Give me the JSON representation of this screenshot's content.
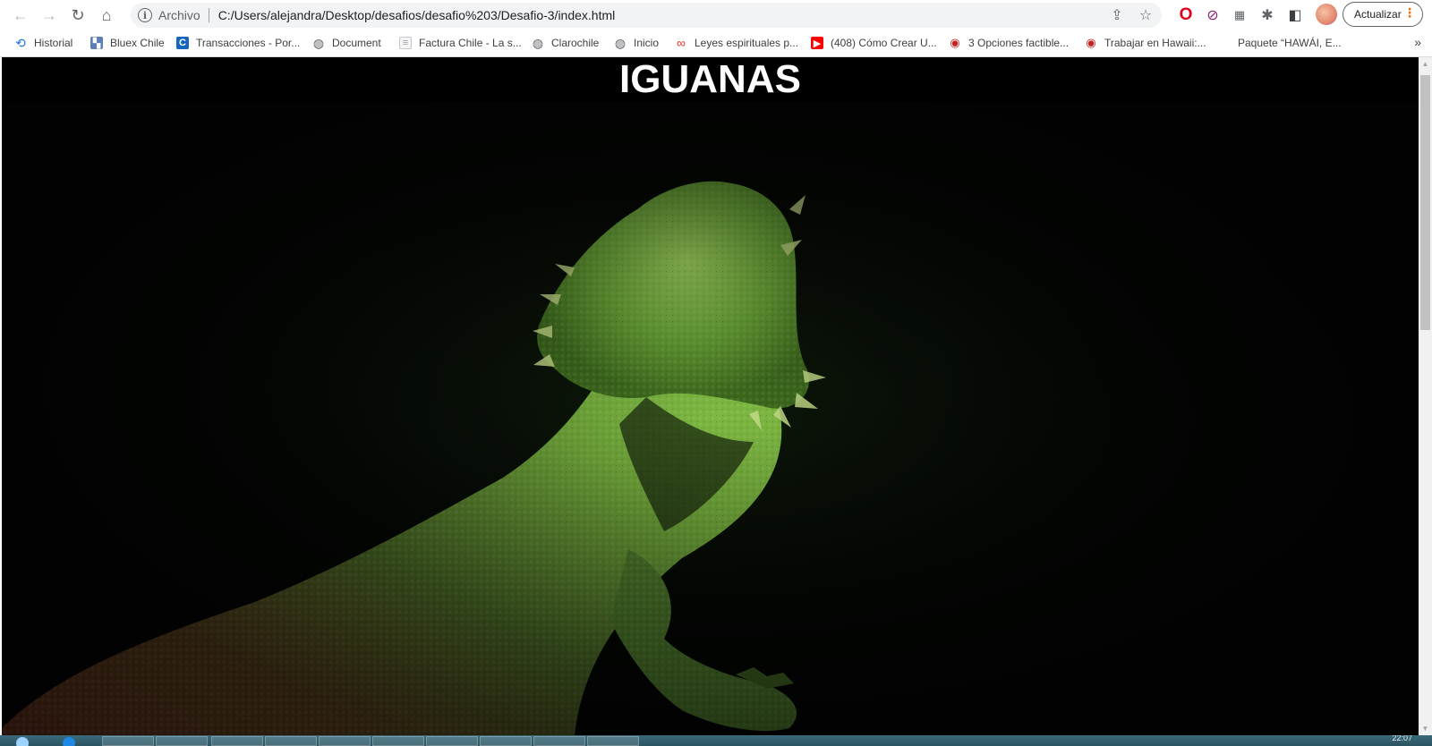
{
  "browser": {
    "omnibox": {
      "scheme_label": "Archivo",
      "url": "C:/Users/alejandra/Desktop/desafios/desafio%203/Desafio-3/index.html"
    },
    "update_label": "Actualizar",
    "bookmarks": [
      {
        "label": "Historial",
        "icon": "history-icon"
      },
      {
        "label": "Bluex Chile",
        "icon": "bluex-favicon"
      },
      {
        "label": "Transacciones - Por...",
        "icon": "transactions-favicon"
      },
      {
        "label": "Document",
        "icon": "globe-icon"
      },
      {
        "label": "Factura Chile - La s...",
        "icon": "document-favicon"
      },
      {
        "label": "Clarochile",
        "icon": "globe-icon"
      },
      {
        "label": "Inicio",
        "icon": "globe-icon"
      },
      {
        "label": "Leyes espirituales p...",
        "icon": "leyes-favicon"
      },
      {
        "label": "(408) Cómo Crear U...",
        "icon": "youtube-icon"
      },
      {
        "label": "3 Opciones factible...",
        "icon": "red-circle-favicon"
      },
      {
        "label": "Trabajar en Hawaii:...",
        "icon": "red-circle-favicon"
      },
      {
        "label": "Paquete “HAWÁI, E...",
        "icon": "none"
      }
    ]
  },
  "page": {
    "title": "IGUANAS",
    "hero_image": "bearded-dragon-photo"
  },
  "taskbar": {
    "clock": "22:07"
  }
}
